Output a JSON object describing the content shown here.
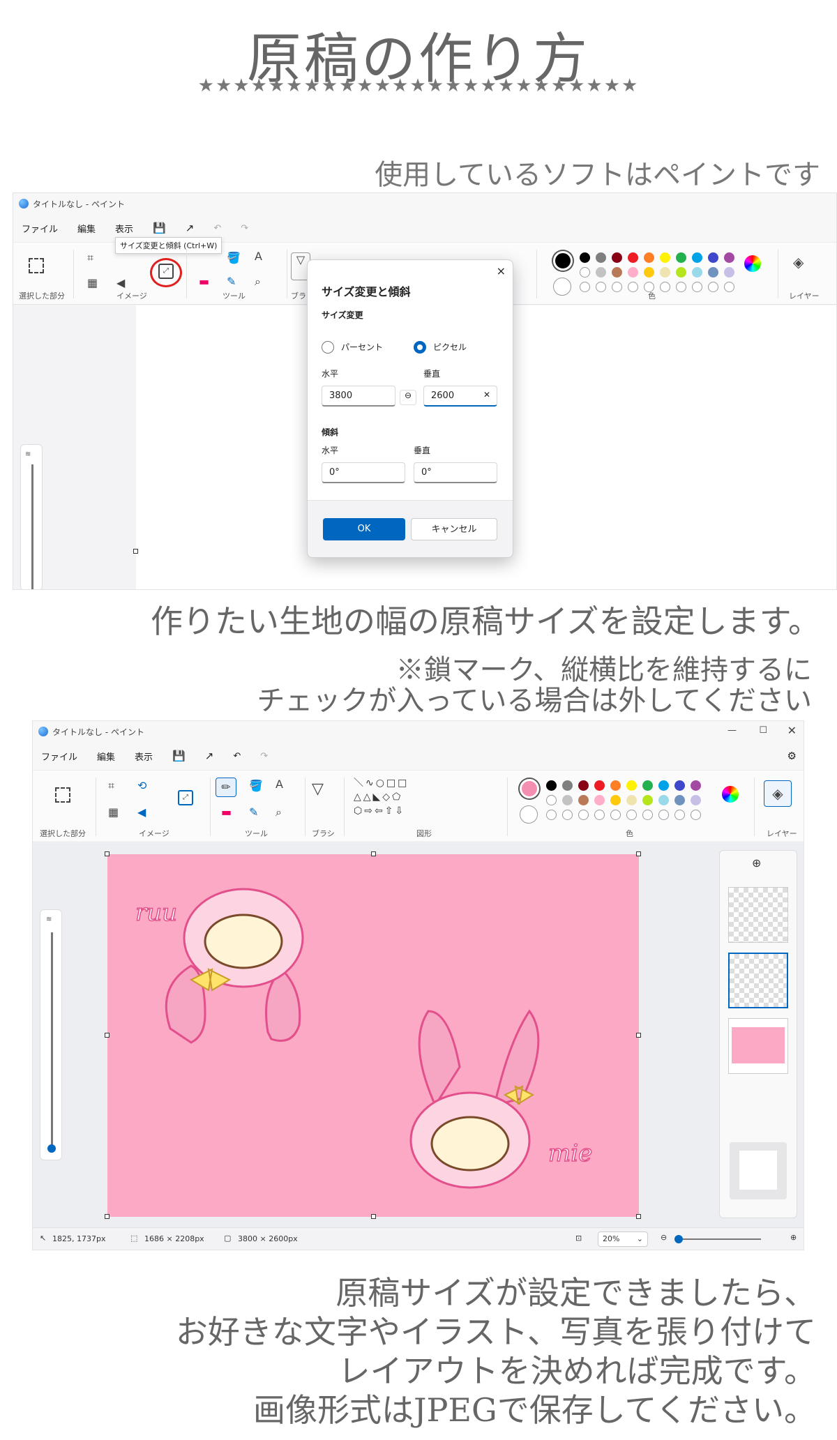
{
  "heading": {
    "title": "原稿の作り方",
    "stars": "★★★★★★★★★★★★★★★★★★★★★★★★★"
  },
  "captions": {
    "software": "使用しているソフトはペイントです",
    "set_size": "作りたい生地の幅の原稿サイズを設定します。",
    "note_line1": "※鎖マーク、縦横比を維持するに",
    "note_line2": "チェックが入っている場合は外してください",
    "final_line1": "原稿サイズが設定できましたら、",
    "final_line2": "お好きな文字やイラスト、写真を張り付けて",
    "final_line3": "レイアウトを決めれば完成です。",
    "final_line4": "画像形式はJPEGで保存してください。"
  },
  "paint1": {
    "window_title": "タイトルなし - ペイント",
    "menu": [
      "ファイル",
      "編集",
      "表示"
    ],
    "tooltip": "サイズ変更と傾斜 (Ctrl+W)",
    "groups": {
      "selection": "選択した部分",
      "image": "イメージ",
      "tools": "ツール",
      "brush": "ブラシ",
      "colors": "色",
      "layers": "レイヤー"
    },
    "dialog": {
      "title": "サイズ変更と傾斜",
      "resize_section": "サイズ変更",
      "option_percent": "パーセント",
      "option_pixel": "ピクセル",
      "selected_option": "ピクセル",
      "horizontal_label": "水平",
      "vertical_label": "垂直",
      "horizontal_value": "3800",
      "vertical_value": "2600",
      "skew_section": "傾斜",
      "skew_horizontal_label": "水平",
      "skew_vertical_label": "垂直",
      "skew_horizontal_value": "0°",
      "skew_vertical_value": "0°",
      "ok_label": "OK",
      "cancel_label": "キャンセル"
    }
  },
  "paint2": {
    "window_title": "タイトルなし - ペイント",
    "menu": [
      "ファイル",
      "編集",
      "表示"
    ],
    "groups": {
      "selection": "選択した部分",
      "image": "イメージ",
      "tools": "ツール",
      "brush": "ブラシ",
      "shapes": "図形",
      "colors": "色",
      "layers": "レイヤー"
    },
    "canvas_texts": {
      "left": "ruu",
      "right": "mie"
    },
    "status": {
      "cursor": "1825, 1737px",
      "selection": "1686 × 2208px",
      "canvas_size": "3800 × 2600px",
      "zoom": "20%"
    }
  },
  "palette": {
    "row1": [
      "#000000",
      "#7f7f7f",
      "#880015",
      "#ed1c24",
      "#ff7f27",
      "#fff200",
      "#22b14c",
      "#00a2e8",
      "#3f48cc",
      "#a349a4"
    ],
    "row2": [
      "#ffffff",
      "#c3c3c3",
      "#b97a57",
      "#ffaec9",
      "#ffc90e",
      "#efe4b0",
      "#b5e61d",
      "#99d9ea",
      "#7092be",
      "#c8bfe7"
    ],
    "primary1": "#000000",
    "primary2": "#f48fb1",
    "canvas_pink": "#fba9c5",
    "accent_blue": "#0067c0",
    "annotation_red": "#e0201e"
  }
}
